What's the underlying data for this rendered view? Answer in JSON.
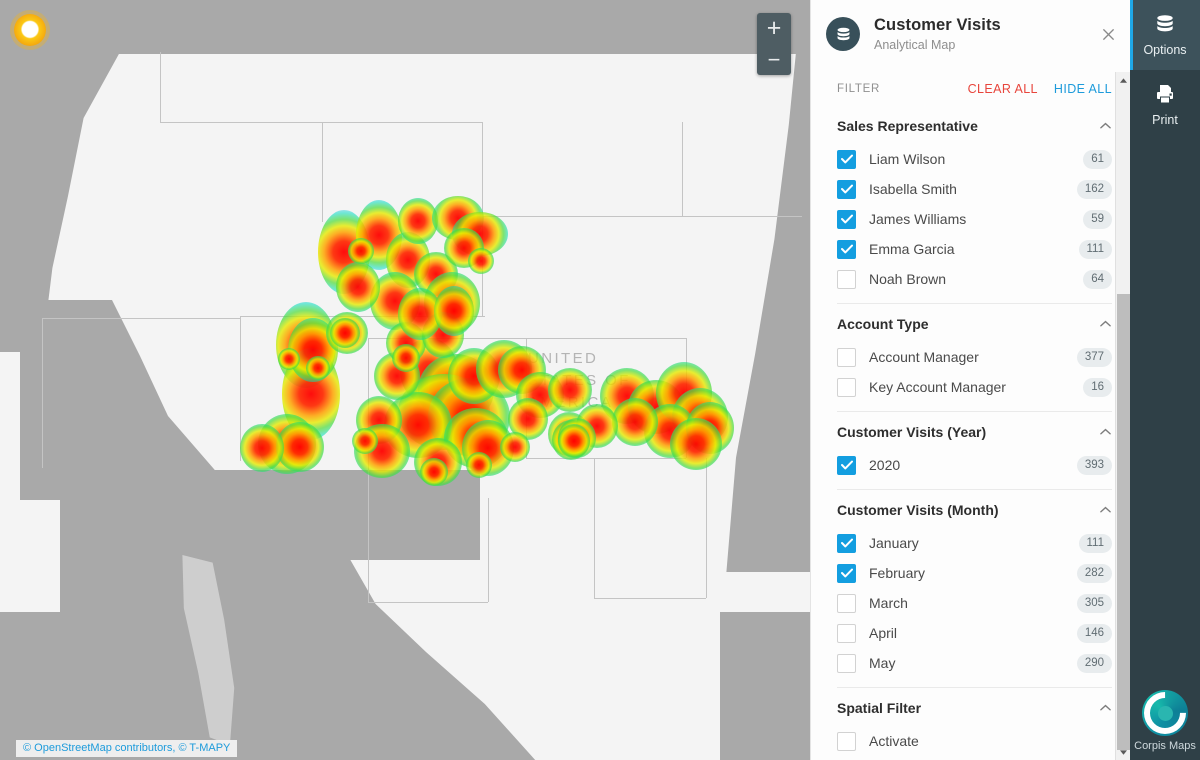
{
  "map": {
    "label": "UNITED STATES OF AMERICA",
    "attribution": "© OpenStreetMap contributors, © T-MAPY",
    "gps_marker": "location-marker",
    "zoom_in": "+",
    "zoom_out": "−",
    "visualization": "heatmap"
  },
  "panel": {
    "icon": "database-icon",
    "title": "Customer Visits",
    "subtitle": "Analytical Map",
    "close": "×",
    "filter_label": "FILTER",
    "clear_all": "CLEAR ALL",
    "hide_all": "HIDE ALL",
    "collapse_chevron": "⌃",
    "sections": [
      {
        "title": "Sales Representative",
        "options": [
          {
            "label": "Liam Wilson",
            "count": "61",
            "checked": true
          },
          {
            "label": "Isabella Smith",
            "count": "162",
            "checked": true
          },
          {
            "label": "James Williams",
            "count": "59",
            "checked": true
          },
          {
            "label": "Emma Garcia",
            "count": "111",
            "checked": true
          },
          {
            "label": "Noah Brown",
            "count": "64",
            "checked": false
          }
        ]
      },
      {
        "title": "Account Type",
        "options": [
          {
            "label": "Account Manager",
            "count": "377",
            "checked": false
          },
          {
            "label": "Key Account Manager",
            "count": "16",
            "checked": false
          }
        ]
      },
      {
        "title": "Customer Visits (Year)",
        "options": [
          {
            "label": "2020",
            "count": "393",
            "checked": true
          }
        ]
      },
      {
        "title": "Customer Visits (Month)",
        "options": [
          {
            "label": "January",
            "count": "111",
            "checked": true
          },
          {
            "label": "February",
            "count": "282",
            "checked": true
          },
          {
            "label": "March",
            "count": "305",
            "checked": false
          },
          {
            "label": "April",
            "count": "146",
            "checked": false
          },
          {
            "label": "May",
            "count": "290",
            "checked": false
          }
        ]
      },
      {
        "title": "Spatial Filter",
        "options": [
          {
            "label": "Activate",
            "count": "",
            "checked": false
          }
        ]
      }
    ],
    "scrollbar": {
      "up": "▲",
      "down": "▼"
    }
  },
  "rail": {
    "items": [
      {
        "label": "Options",
        "icon": "database-icon",
        "active": true
      },
      {
        "label": "Print",
        "icon": "printer-icon",
        "active": false
      }
    ],
    "logo_label": "Corpis Maps",
    "logo_icon": "corpis-c-logo"
  },
  "colors": {
    "accent_blue": "#139ee0",
    "clear_red": "#e8453c",
    "rail_bg": "#2f4047",
    "rail_active": "#3d525b",
    "rail_active_border": "#1fa8e8",
    "map_land": "#f4f4f4",
    "map_outside": "#a9a9a9",
    "marker_orange": "#f5a70d",
    "logo_teal": "#17b9ab"
  }
}
